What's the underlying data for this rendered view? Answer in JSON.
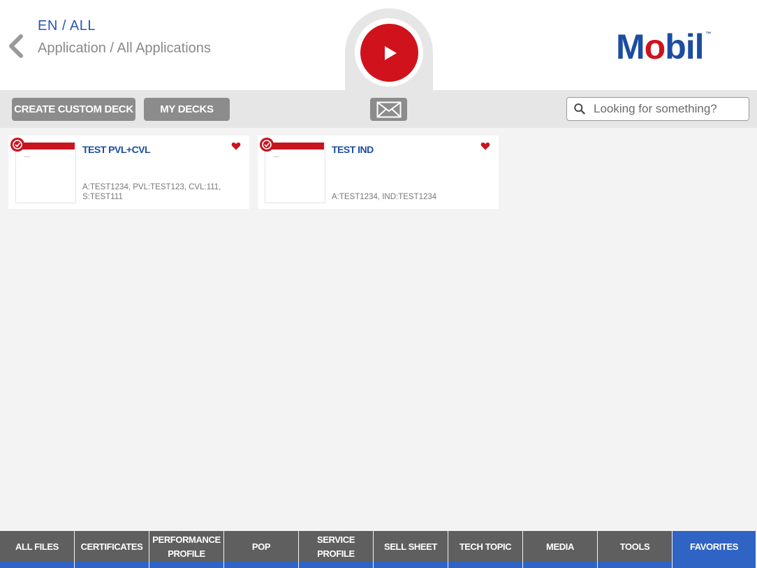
{
  "header": {
    "breadcrumb_top": "EN / ALL",
    "breadcrumb_sub": "Application / All Applications",
    "logo_text_pre": "M",
    "logo_text_o": "o",
    "logo_text_post": "bil",
    "logo_tm": "™"
  },
  "toolbar": {
    "create_label": "CREATE CUSTOM DECK",
    "mydecks_label": "MY DECKS",
    "search_placeholder": "Looking for something?"
  },
  "cards": [
    {
      "title": "TEST PVL+CVL",
      "thumb_text": "---",
      "tags": "A:TEST1234, PVL:TEST123, CVL:111, S:TEST111",
      "favorited": true
    },
    {
      "title": "TEST IND",
      "thumb_text": "---",
      "tags": "A:TEST1234, IND:TEST1234",
      "favorited": true
    }
  ],
  "bottom_nav": {
    "items": [
      {
        "label": "ALL FILES"
      },
      {
        "label": "CERTIFICATES"
      },
      {
        "label": "PERFORMANCE PROFILE"
      },
      {
        "label": "POP"
      },
      {
        "label": "SERVICE PROFILE"
      },
      {
        "label": "SELL SHEET"
      },
      {
        "label": "TECH TOPIC"
      },
      {
        "label": "MEDIA"
      },
      {
        "label": "TOOLS"
      },
      {
        "label": "FAVORITES"
      }
    ],
    "active": "FAVORITES"
  },
  "colors": {
    "brand_blue": "#1c4da1",
    "brand_red": "#d0121c",
    "nav_active": "#2f64c4",
    "nav_bg": "#5f5f5f"
  }
}
